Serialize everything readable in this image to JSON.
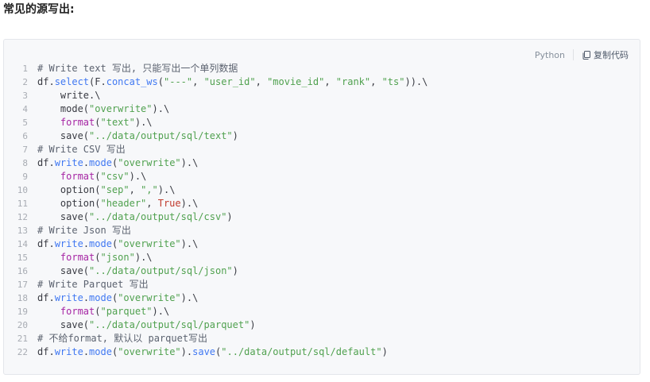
{
  "heading": "常见的源写出:",
  "toolbar": {
    "language": "Python",
    "copy_label": "复制代码",
    "copy_icon": "copy-icon"
  },
  "code": {
    "lines": [
      [
        {
          "t": "# Write text 写出, 只能写出一个单列数据",
          "c": "comment"
        }
      ],
      [
        {
          "t": "df.",
          "c": "plain"
        },
        {
          "t": "select",
          "c": "method"
        },
        {
          "t": "(F.",
          "c": "plain"
        },
        {
          "t": "concat_ws",
          "c": "method"
        },
        {
          "t": "(",
          "c": "plain"
        },
        {
          "t": "\"---\"",
          "c": "str"
        },
        {
          "t": ", ",
          "c": "plain"
        },
        {
          "t": "\"user_id\"",
          "c": "str"
        },
        {
          "t": ", ",
          "c": "plain"
        },
        {
          "t": "\"movie_id\"",
          "c": "str"
        },
        {
          "t": ", ",
          "c": "plain"
        },
        {
          "t": "\"rank\"",
          "c": "str"
        },
        {
          "t": ", ",
          "c": "plain"
        },
        {
          "t": "\"ts\"",
          "c": "str"
        },
        {
          "t": ")).\\",
          "c": "plain"
        }
      ],
      [
        {
          "t": "    write.\\",
          "c": "plain"
        }
      ],
      [
        {
          "t": "    mode(",
          "c": "plain"
        },
        {
          "t": "\"overwrite\"",
          "c": "str"
        },
        {
          "t": ").\\",
          "c": "plain"
        }
      ],
      [
        {
          "t": "    ",
          "c": "plain"
        },
        {
          "t": "format",
          "c": "kw"
        },
        {
          "t": "(",
          "c": "plain"
        },
        {
          "t": "\"text\"",
          "c": "str"
        },
        {
          "t": ").\\",
          "c": "plain"
        }
      ],
      [
        {
          "t": "    save(",
          "c": "plain"
        },
        {
          "t": "\"../data/output/sql/text\"",
          "c": "str"
        },
        {
          "t": ")",
          "c": "plain"
        }
      ],
      [
        {
          "t": "# Write CSV 写出",
          "c": "comment"
        }
      ],
      [
        {
          "t": "df.",
          "c": "plain"
        },
        {
          "t": "write",
          "c": "method"
        },
        {
          "t": ".",
          "c": "plain"
        },
        {
          "t": "mode",
          "c": "method"
        },
        {
          "t": "(",
          "c": "plain"
        },
        {
          "t": "\"overwrite\"",
          "c": "str"
        },
        {
          "t": ").\\",
          "c": "plain"
        }
      ],
      [
        {
          "t": "    ",
          "c": "plain"
        },
        {
          "t": "format",
          "c": "kw"
        },
        {
          "t": "(",
          "c": "plain"
        },
        {
          "t": "\"csv\"",
          "c": "str"
        },
        {
          "t": ").\\",
          "c": "plain"
        }
      ],
      [
        {
          "t": "    option(",
          "c": "plain"
        },
        {
          "t": "\"sep\"",
          "c": "str"
        },
        {
          "t": ", ",
          "c": "plain"
        },
        {
          "t": "\",\"",
          "c": "str"
        },
        {
          "t": ").\\",
          "c": "plain"
        }
      ],
      [
        {
          "t": "    option(",
          "c": "plain"
        },
        {
          "t": "\"header\"",
          "c": "str"
        },
        {
          "t": ", ",
          "c": "plain"
        },
        {
          "t": "True",
          "c": "bool"
        },
        {
          "t": ").\\",
          "c": "plain"
        }
      ],
      [
        {
          "t": "    save(",
          "c": "plain"
        },
        {
          "t": "\"../data/output/sql/csv\"",
          "c": "str"
        },
        {
          "t": ")",
          "c": "plain"
        }
      ],
      [
        {
          "t": "# Write Json 写出",
          "c": "comment"
        }
      ],
      [
        {
          "t": "df.",
          "c": "plain"
        },
        {
          "t": "write",
          "c": "method"
        },
        {
          "t": ".",
          "c": "plain"
        },
        {
          "t": "mode",
          "c": "method"
        },
        {
          "t": "(",
          "c": "plain"
        },
        {
          "t": "\"overwrite\"",
          "c": "str"
        },
        {
          "t": ").\\",
          "c": "plain"
        }
      ],
      [
        {
          "t": "    ",
          "c": "plain"
        },
        {
          "t": "format",
          "c": "kw"
        },
        {
          "t": "(",
          "c": "plain"
        },
        {
          "t": "\"json\"",
          "c": "str"
        },
        {
          "t": ").\\",
          "c": "plain"
        }
      ],
      [
        {
          "t": "    save(",
          "c": "plain"
        },
        {
          "t": "\"../data/output/sql/json\"",
          "c": "str"
        },
        {
          "t": ")",
          "c": "plain"
        }
      ],
      [
        {
          "t": "# Write Parquet 写出",
          "c": "comment"
        }
      ],
      [
        {
          "t": "df.",
          "c": "plain"
        },
        {
          "t": "write",
          "c": "method"
        },
        {
          "t": ".",
          "c": "plain"
        },
        {
          "t": "mode",
          "c": "method"
        },
        {
          "t": "(",
          "c": "plain"
        },
        {
          "t": "\"overwrite\"",
          "c": "str"
        },
        {
          "t": ").\\",
          "c": "plain"
        }
      ],
      [
        {
          "t": "    ",
          "c": "plain"
        },
        {
          "t": "format",
          "c": "kw"
        },
        {
          "t": "(",
          "c": "plain"
        },
        {
          "t": "\"parquet\"",
          "c": "str"
        },
        {
          "t": ").\\",
          "c": "plain"
        }
      ],
      [
        {
          "t": "    save(",
          "c": "plain"
        },
        {
          "t": "\"../data/output/sql/parquet\"",
          "c": "str"
        },
        {
          "t": ")",
          "c": "plain"
        }
      ],
      [
        {
          "t": "# 不给format, 默认以 parquet写出",
          "c": "comment"
        }
      ],
      [
        {
          "t": "df.",
          "c": "plain"
        },
        {
          "t": "write",
          "c": "method"
        },
        {
          "t": ".",
          "c": "plain"
        },
        {
          "t": "mode",
          "c": "method"
        },
        {
          "t": "(",
          "c": "plain"
        },
        {
          "t": "\"overwrite\"",
          "c": "str"
        },
        {
          "t": ").",
          "c": "plain"
        },
        {
          "t": "save",
          "c": "method"
        },
        {
          "t": "(",
          "c": "plain"
        },
        {
          "t": "\"../data/output/sql/default\"",
          "c": "str"
        },
        {
          "t": ")",
          "c": "plain"
        }
      ]
    ]
  }
}
